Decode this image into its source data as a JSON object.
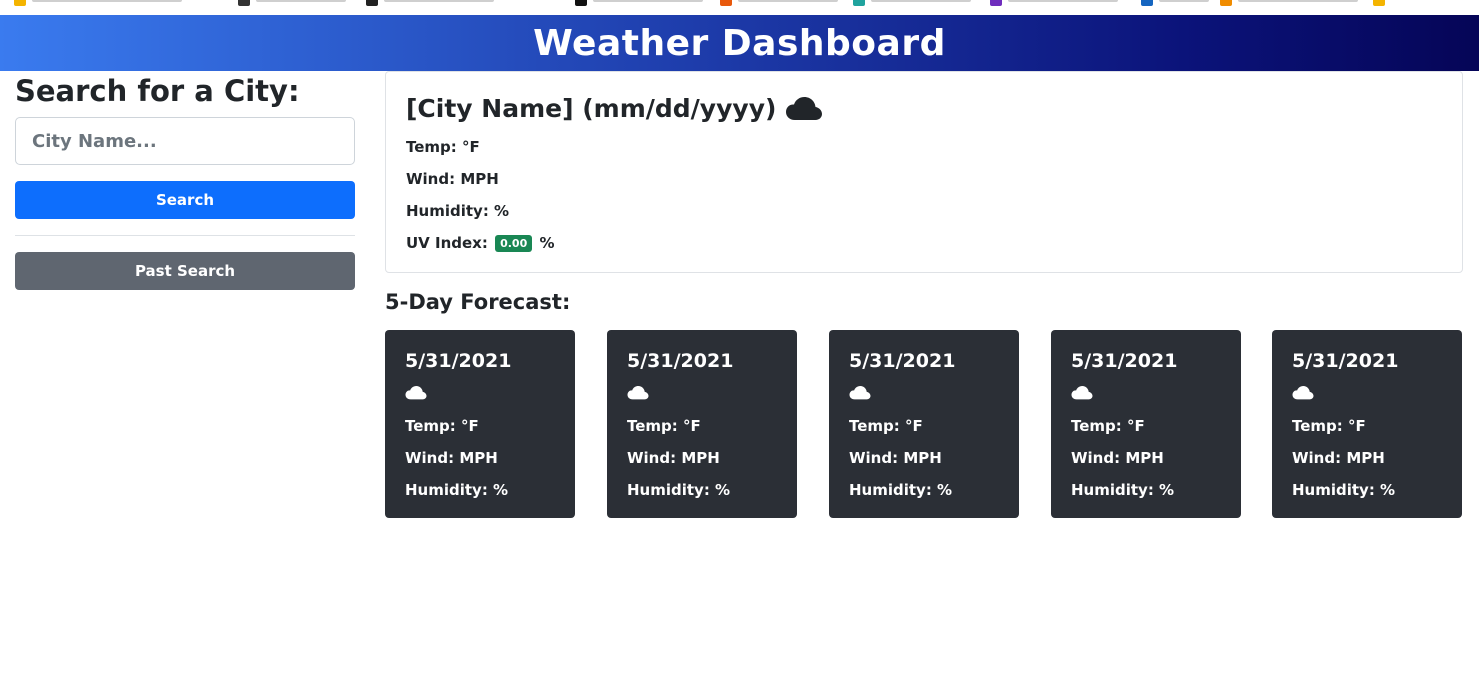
{
  "header": {
    "title": "Weather Dashboard"
  },
  "sidebar": {
    "title": "Search for a City:",
    "input_placeholder": "City Name...",
    "search_label": "Search",
    "past_search_label": "Past Search"
  },
  "current": {
    "title": "[City Name] (mm/dd/yyyy)",
    "icon": "cloud-icon",
    "temp": "Temp: °F",
    "wind": "Wind: MPH",
    "humidity": "Humidity: %",
    "uv_label": "UV Index:",
    "uv_value": "0.00",
    "uv_suffix": "%"
  },
  "forecast": {
    "title": "5-Day Forecast:",
    "days": [
      {
        "date": "5/31/2021",
        "icon": "cloud-icon",
        "temp": "Temp: °F",
        "wind": "Wind: MPH",
        "humidity": "Humidity: %"
      },
      {
        "date": "5/31/2021",
        "icon": "cloud-icon",
        "temp": "Temp: °F",
        "wind": "Wind: MPH",
        "humidity": "Humidity: %"
      },
      {
        "date": "5/31/2021",
        "icon": "cloud-icon",
        "temp": "Temp: °F",
        "wind": "Wind: MPH",
        "humidity": "Humidity: %"
      },
      {
        "date": "5/31/2021",
        "icon": "cloud-icon",
        "temp": "Temp: °F",
        "wind": "Wind: MPH",
        "humidity": "Humidity: %"
      },
      {
        "date": "5/31/2021",
        "icon": "cloud-icon",
        "temp": "Temp: °F",
        "wind": "Wind: MPH",
        "humidity": "Humidity: %"
      }
    ]
  },
  "colors": {
    "primary": "#0d6efd",
    "secondary": "#5f6670",
    "uv_badge": "#198754",
    "forecast_card": "#2b2f36"
  }
}
